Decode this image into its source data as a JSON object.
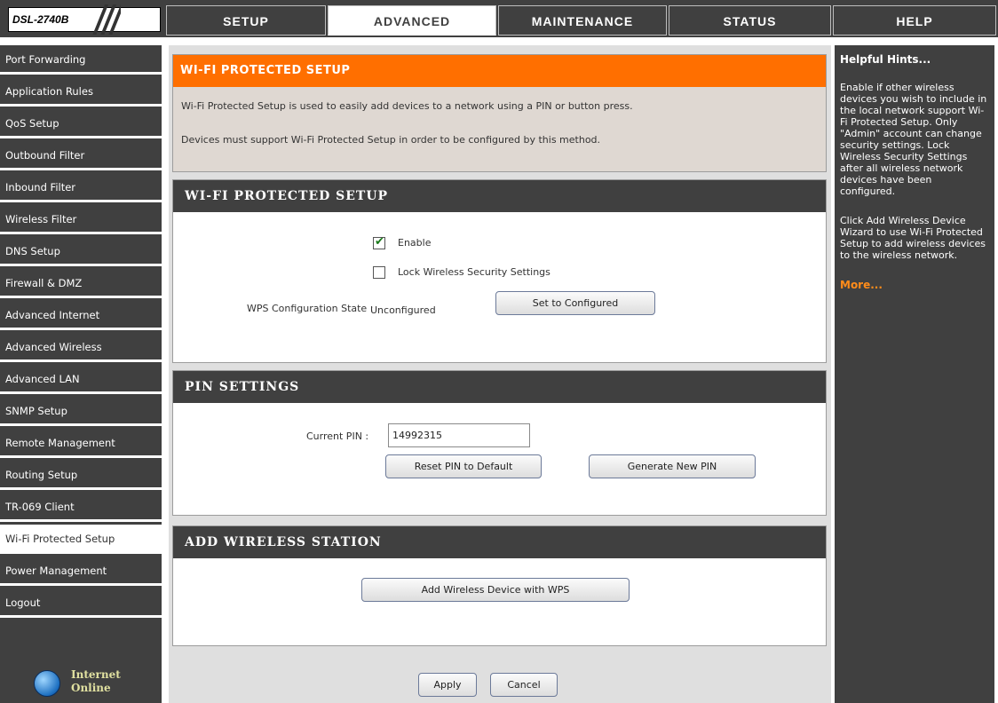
{
  "brand": {
    "model": "DSL-2740B"
  },
  "nav": {
    "tabs": [
      {
        "label": "SETUP"
      },
      {
        "label": "ADVANCED"
      },
      {
        "label": "MAINTENANCE"
      },
      {
        "label": "STATUS"
      },
      {
        "label": "HELP"
      }
    ],
    "active": "ADVANCED"
  },
  "sidebar": {
    "items": [
      {
        "label": "Port Forwarding"
      },
      {
        "label": "Application Rules"
      },
      {
        "label": "QoS Setup"
      },
      {
        "label": "Outbound Filter"
      },
      {
        "label": "Inbound Filter"
      },
      {
        "label": "Wireless Filter"
      },
      {
        "label": "DNS Setup"
      },
      {
        "label": "Firewall & DMZ"
      },
      {
        "label": "Advanced Internet"
      },
      {
        "label": "Advanced Wireless"
      },
      {
        "label": "Advanced LAN"
      },
      {
        "label": "SNMP Setup"
      },
      {
        "label": "Remote Management"
      },
      {
        "label": "Routing Setup"
      },
      {
        "label": "TR-069 Client"
      },
      {
        "label": "Wi-Fi Protected Setup"
      },
      {
        "label": "Power Management"
      },
      {
        "label": "Logout"
      }
    ],
    "active": "Wi-Fi Protected Setup",
    "status": {
      "line1": "Internet",
      "line2": "Online",
      "icon": "globe-icon"
    }
  },
  "intro": {
    "title": "WI-FI PROTECTED SETUP",
    "line1": "Wi-Fi Protected Setup is used to easily add devices to a network using a PIN or button press.",
    "line2": "Devices must support Wi-Fi Protected Setup in order to be configured by this method."
  },
  "wps": {
    "title": "WI-FI PROTECTED SETUP",
    "enable_label": "Enable",
    "enable_checked": true,
    "lock_label": "Lock Wireless Security Settings",
    "lock_checked": false,
    "state_label": "WPS Configuration State :",
    "state_value": "Unconfigured",
    "set_configured_button": "Set to Configured"
  },
  "pin": {
    "title": "PIN SETTINGS",
    "current_label": "Current PIN :",
    "current_value": "14992315",
    "reset_button": "Reset PIN to Default",
    "generate_button": "Generate New PIN"
  },
  "station": {
    "title": "ADD WIRELESS STATION",
    "add_button": "Add Wireless Device with WPS"
  },
  "actions": {
    "apply": "Apply",
    "cancel": "Cancel"
  },
  "help": {
    "title": "Helpful Hints...",
    "p1": "Enable if other wireless devices you wish to include in the local network support Wi-Fi Protected Setup. Only \"Admin\" account can change security settings. Lock Wireless Security Settings after all wireless network devices have been configured.",
    "p2": "Click Add Wireless Device Wizard to use Wi-Fi Protected Setup to add wireless devices to the wireless network.",
    "more": "More..."
  },
  "colors": {
    "dark_gray": "#404040",
    "orange": "#ff6f00",
    "panel_bg": "#dfdfdf",
    "intro_bg": "#dfd8d2",
    "link_orange": "#ff8c1a"
  }
}
